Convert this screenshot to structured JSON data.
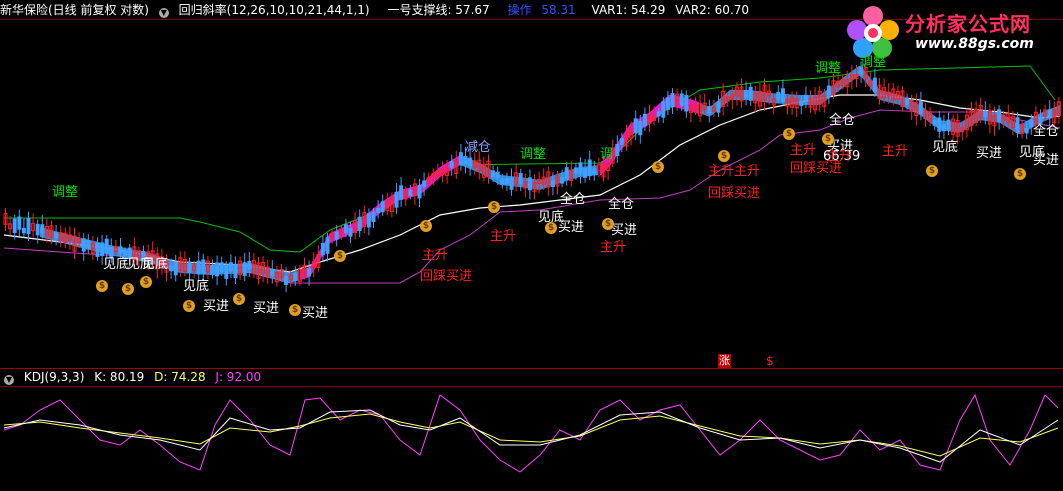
{
  "header": {
    "title": "新华保险(日线 前复权 对数)",
    "indicator": "回归斜率(12,26,10,10,21,44,1,1)",
    "support_label": "一号支撑线: 57.67",
    "op_label": "操作",
    "op_value": "58.31",
    "var1": "VAR1: 54.29",
    "var2": "VAR2: 60.70",
    "circle_glyph": "▼"
  },
  "kdj": {
    "name": "KDJ(9,3,3)",
    "k": "K: 80.19",
    "d": "D: 74.28",
    "j": "J: 92.00"
  },
  "logo": {
    "text": "分析家公式网",
    "url": "www.88gs.com"
  },
  "markers": {
    "zhang": "涨",
    "dollar": "$"
  },
  "signals": [
    {
      "text": "调整",
      "color": "#00e000"
    },
    {
      "text": "见底",
      "color": "#ffffff"
    },
    {
      "text": "见底",
      "color": "#ffffff"
    },
    {
      "text": "见底",
      "color": "#ffffff"
    },
    {
      "text": "买进",
      "color": "#ffffff"
    },
    {
      "text": "买进",
      "color": "#ffffff"
    },
    {
      "text": "见底",
      "color": "#ffffff"
    },
    {
      "text": "买进",
      "color": "#ffffff"
    },
    {
      "text": "主升",
      "color": "#ff2020"
    },
    {
      "text": "回踩买进",
      "color": "#ff2020"
    },
    {
      "text": "减仓",
      "color": "#8fa0ff"
    },
    {
      "text": "调整",
      "color": "#00e000"
    },
    {
      "text": "主升",
      "color": "#ff2020"
    },
    {
      "text": "见底",
      "color": "#ffffff"
    },
    {
      "text": "买进",
      "color": "#ffffff"
    },
    {
      "text": "全仓",
      "color": "#ffffff"
    },
    {
      "text": "全仓",
      "color": "#ffffff"
    },
    {
      "text": "买进",
      "color": "#ffffff"
    },
    {
      "text": "主升",
      "color": "#ff2020"
    },
    {
      "text": "调",
      "color": "#00e000"
    },
    {
      "text": "主升主升",
      "color": "#ff2020"
    },
    {
      "text": "回踩买进",
      "color": "#ff2020"
    },
    {
      "text": "调整",
      "color": "#00e000"
    },
    {
      "text": "66.39",
      "color": "#ffffff"
    },
    {
      "text": "调整",
      "color": "#00e000"
    },
    {
      "text": "全仓",
      "color": "#ffffff"
    },
    {
      "text": "主升",
      "color": "#ff2020"
    },
    {
      "text": "回踩买进",
      "color": "#ff2020"
    },
    {
      "text": "买进",
      "color": "#ffffff"
    },
    {
      "text": "主升",
      "color": "#ff2020"
    },
    {
      "text": "主升",
      "color": "#ff2020"
    },
    {
      "text": "见底",
      "color": "#ffffff"
    },
    {
      "text": "买进",
      "color": "#ffffff"
    },
    {
      "text": "见底",
      "color": "#ffffff"
    },
    {
      "text": "全仓",
      "color": "#ffffff"
    },
    {
      "text": "买进",
      "color": "#ffffff"
    }
  ],
  "colors": {
    "up": "#ff2020",
    "down": "#3fa0ff",
    "band_upper": "#3fa0ff",
    "band_lower": "#ff20ff",
    "white_line": "#ffffff",
    "green_line": "#00c000",
    "magenta_line": "#c040c0",
    "k_line": "#ffffff",
    "d_line": "#ffff60",
    "j_line": "#ff40ff",
    "frame": "#a00000"
  }
}
